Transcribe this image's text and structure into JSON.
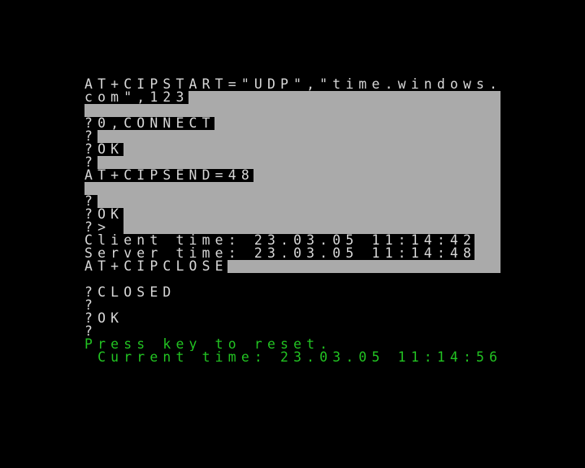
{
  "terminal": {
    "lines": [
      "AT+CIPSTART=\"UDP\",\"time.windows.",
      "com\",123",
      "",
      "?0,CONNECT",
      "?",
      "?OK",
      "?",
      "AT+CIPSEND=48",
      "",
      "?",
      "?OK",
      "?>",
      "Client time: 23.03.05 11:14:42",
      "Server time: 23.03.05 11:14:48",
      "AT+CIPCLOSE",
      "",
      "?CLOSED",
      "?",
      "?OK",
      "?"
    ],
    "prompt": "Press key to reset.",
    "current_time": " Current time: 23.03.05 11:14:56"
  },
  "colors": {
    "background": "#000000",
    "text": "#d8d8d8",
    "highlight": "#aaaaaa",
    "prompt": "#22c322"
  }
}
